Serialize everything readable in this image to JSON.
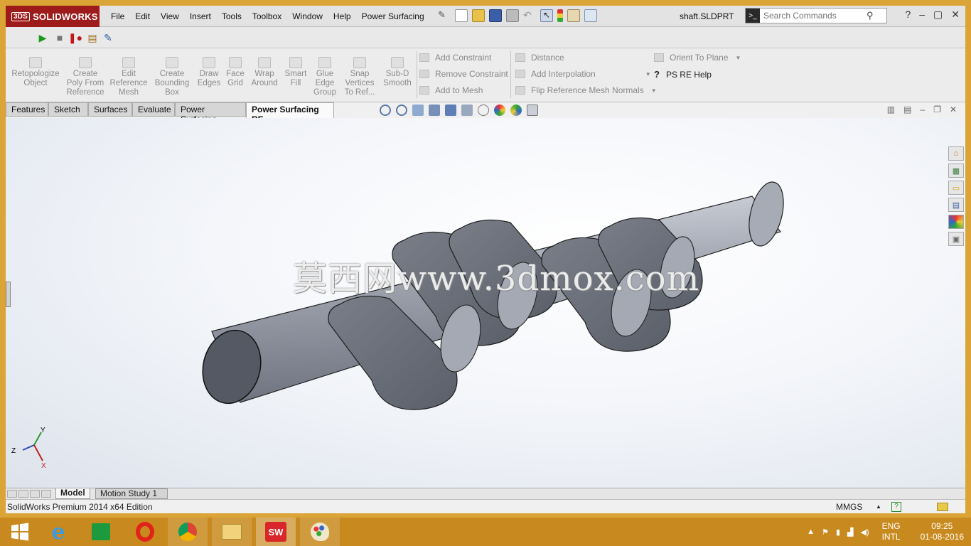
{
  "app": {
    "brand": "SOLIDWORKS",
    "brand_prefix": "3DS",
    "document_title": "shaft.SLDPRT"
  },
  "menu": [
    "File",
    "Edit",
    "View",
    "Insert",
    "Tools",
    "Toolbox",
    "Window",
    "Help",
    "Power Surfacing"
  ],
  "search": {
    "placeholder": "Search Commands"
  },
  "command_manager": {
    "large_buttons": [
      {
        "label": "Retopologize Object"
      },
      {
        "label": "Create Poly From Reference"
      },
      {
        "label": "Edit Reference Mesh"
      },
      {
        "label": "Create Bounding Box"
      },
      {
        "label": "Draw Edges"
      },
      {
        "label": "Face Grid"
      },
      {
        "label": "Wrap Around"
      },
      {
        "label": "Smart Fill"
      },
      {
        "label": "Glue Edge Group"
      },
      {
        "label": "Snap Vertices To Ref..."
      },
      {
        "label": "Sub-D Smooth"
      }
    ],
    "group1": [
      "Add Constraint",
      "Remove Constraint",
      "Add to Mesh"
    ],
    "group2": [
      "Distance",
      "Add Interpolation",
      "Flip Reference Mesh Normals"
    ],
    "group3": [
      "Orient To Plane",
      "PS RE Help"
    ]
  },
  "tabs": [
    "Features",
    "Sketch",
    "Surfaces",
    "Evaluate",
    "Power Surfacing",
    "Power Surfacing RE"
  ],
  "active_tab": "Power Surfacing RE",
  "watermark": "莫西网www.3dmox.com",
  "triad": {
    "x": "X",
    "y": "Y",
    "z": "Z"
  },
  "bottom_tabs": [
    "Model",
    "Motion Study 1"
  ],
  "status": {
    "edition": "SolidWorks Premium 2014 x64 Edition",
    "units": "MMGS",
    "units_arrow": "▲"
  },
  "tray": {
    "lang_top": "ENG",
    "lang_bottom": "INTL",
    "time": "09:25",
    "date": "01-08-2016"
  },
  "colors": {
    "frame": "#dba436",
    "taskbar": "#c88a1e",
    "brand_red": "#9e1b1b",
    "part_gray": "#8e929c"
  }
}
